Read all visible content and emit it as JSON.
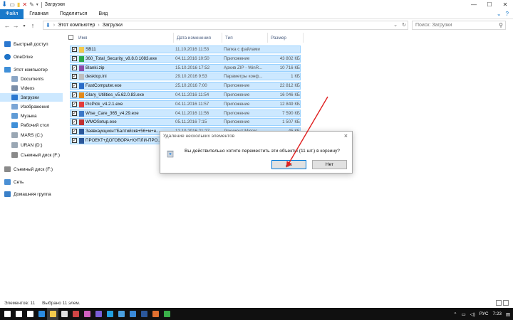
{
  "window": {
    "title": "Загрузки",
    "caption": {
      "minimize": "—",
      "maximize": "☐",
      "close": "✕"
    }
  },
  "ribbon": {
    "tabs": [
      "Файл",
      "Главная",
      "Поделиться",
      "Вид"
    ]
  },
  "address": {
    "crumbs": [
      "Этот компьютер",
      "Загрузки"
    ],
    "search_placeholder": "Поиск: Загрузки"
  },
  "nav": {
    "items": [
      {
        "label": "Быстрый доступ",
        "icon": "star-icon",
        "color": "#2b78d0"
      },
      {
        "label": "OneDrive",
        "icon": "cloud-icon",
        "color": "#1e73c8"
      },
      {
        "label": "Этот компьютер",
        "icon": "computer-icon",
        "color": "#3f8fd8"
      },
      {
        "label": "Documents",
        "icon": "documents-icon",
        "color": "#8aa6c6"
      },
      {
        "label": "Videos",
        "icon": "videos-icon",
        "color": "#7b8ea8"
      },
      {
        "label": "Загрузки",
        "icon": "download-icon",
        "color": "#2b78d0"
      },
      {
        "label": "Изображения",
        "icon": "pictures-icon",
        "color": "#7ba6d6"
      },
      {
        "label": "Музыка",
        "icon": "music-icon",
        "color": "#5f9bd6"
      },
      {
        "label": "Рабочий стол",
        "icon": "desktop-icon",
        "color": "#3f8fd8"
      },
      {
        "label": "MARS (C:)",
        "icon": "drive-icon",
        "color": "#9aa7b4"
      },
      {
        "label": "URAN (D:)",
        "icon": "drive-icon",
        "color": "#9aa7b4"
      },
      {
        "label": "Съемный диск (F:)",
        "icon": "usb-icon",
        "color": "#8a8a8a"
      },
      {
        "label": "Съемный диск (F:)",
        "icon": "usb-icon",
        "color": "#8a8a8a"
      },
      {
        "label": "Сеть",
        "icon": "network-icon",
        "color": "#4a8fd4"
      },
      {
        "label": "Домашняя группа",
        "icon": "homegroup-icon",
        "color": "#3a80c8"
      }
    ]
  },
  "columns": {
    "name": "Имя",
    "date": "Дата изменения",
    "type": "Тип",
    "size": "Размер"
  },
  "files": [
    {
      "name": "SB11",
      "date": "11.10.2016 11:53",
      "type": "Папка с файлами",
      "size": "",
      "icon": "folder-icon",
      "color": "#f2c94c"
    },
    {
      "name": "360_Total_Security_v8.8.0.1083.exe",
      "date": "04.11.2016 10:50",
      "type": "Приложение",
      "size": "43 802 КБ",
      "icon": "app-icon",
      "color": "#2aa84a"
    },
    {
      "name": "Blanki.zip",
      "date": "15.10.2016 17:52",
      "type": "Архив ZIP - WinR...",
      "size": "10 716 КБ",
      "icon": "archive-icon",
      "color": "#8b4aa8"
    },
    {
      "name": "desktop.ini",
      "date": "29.10.2016 9:53",
      "type": "Параметры конф...",
      "size": "1 КБ",
      "icon": "settings-file-icon",
      "color": "#bfbfbf"
    },
    {
      "name": "FastComputer.exe",
      "date": "25.10.2016 7:00",
      "type": "Приложение",
      "size": "22 812 КБ",
      "icon": "app-icon",
      "color": "#2a6cc8"
    },
    {
      "name": "Glary_Utilities_v5.62.0.83.exe",
      "date": "04.11.2016 11:54",
      "type": "Приложение",
      "size": "16 046 КБ",
      "icon": "app-icon",
      "color": "#e28a1c"
    },
    {
      "name": "PicPick_v4.2.1.exe",
      "date": "04.11.2016 11:57",
      "type": "Приложение",
      "size": "12 849 КБ",
      "icon": "app-icon",
      "color": "#e33c3c"
    },
    {
      "name": "Wise_Care_365_v4.29.exe",
      "date": "04.11.2016 11:56",
      "type": "Приложение",
      "size": "7 590 КБ",
      "icon": "app-icon",
      "color": "#3c78c8"
    },
    {
      "name": "WMOSetup.exe",
      "date": "05.11.2016 7:15",
      "type": "Приложение",
      "size": "1 507 КБ",
      "icon": "app-icon",
      "color": "#c03030"
    },
    {
      "name": "Заявкаукционт'Балтийскв+56+м+н...",
      "date": "12.10.2016 21:27",
      "type": "Документ Micros...",
      "size": "45 КБ",
      "icon": "word-icon",
      "color": "#2b579a"
    },
    {
      "name": "ПРОЕКТ+ДОГОВОРА+КУПЛИ-ПРО...",
      "date": "",
      "type": "",
      "size": "",
      "icon": "word-icon",
      "color": "#2b579a"
    }
  ],
  "dialog": {
    "title": "Удаление нескольких элементов",
    "message": "Вы действительно хотите переместить эти объекты (11 шт.) в корзину?",
    "yes_label": "Да",
    "no_label": "Нет"
  },
  "status": {
    "items_count": "Элементов: 11",
    "selected_count": "Выбрано 11 элем."
  },
  "taskbar": {
    "apps": [
      {
        "icon": "windows-start-icon",
        "color": "#ffffff"
      },
      {
        "icon": "search-icon",
        "color": "#ffffff"
      },
      {
        "icon": "task-view-icon",
        "color": "#ffffff"
      },
      {
        "icon": "edge-icon",
        "color": "#2b8be0"
      },
      {
        "icon": "explorer-icon",
        "color": "#f2c94c"
      },
      {
        "icon": "store-icon",
        "color": "#e0e0e0"
      },
      {
        "icon": "mail-icon",
        "color": "#d04545"
      },
      {
        "icon": "picpick-icon",
        "color": "#d060c0"
      },
      {
        "icon": "viber-icon",
        "color": "#7b5fd8"
      },
      {
        "icon": "skype-icon",
        "color": "#22a0e0"
      },
      {
        "icon": "paint-icon",
        "color": "#4aa0e0"
      },
      {
        "icon": "photos-icon",
        "color": "#3a8ad8"
      },
      {
        "icon": "word-icon",
        "color": "#2b579a"
      },
      {
        "icon": "screenshot-icon",
        "color": "#e07030"
      },
      {
        "icon": "green-app-icon",
        "color": "#3ab04a"
      }
    ],
    "language": "РУС",
    "time": "7:23"
  },
  "colors": {
    "accent": "#1979ca",
    "selection": "#cce8ff",
    "selection_border": "#99d1ff",
    "arrow": "#e02020"
  }
}
